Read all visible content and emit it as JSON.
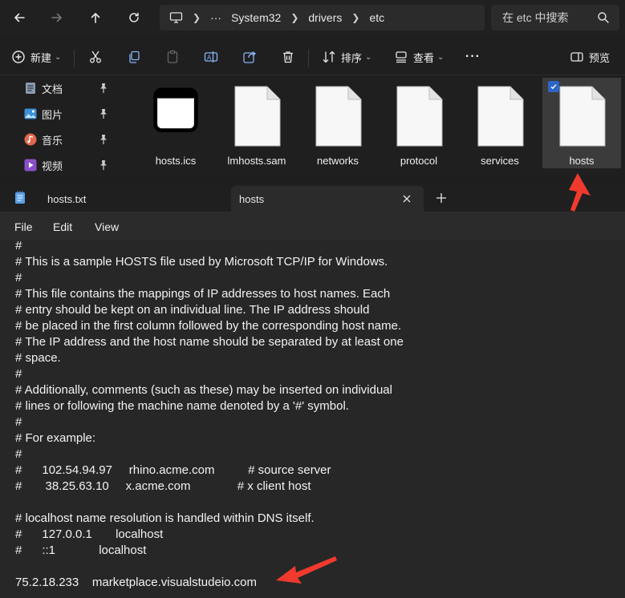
{
  "explorer": {
    "address": {
      "overflow": "···",
      "segments": [
        "System32",
        "drivers",
        "etc"
      ]
    },
    "search_placeholder": "在 etc 中搜索",
    "toolbar": {
      "new_label": "新建",
      "sort_label": "排序",
      "view_label": "查看",
      "more_label": "···",
      "preview_label": "预览"
    },
    "sidebar": [
      {
        "label": "文档",
        "icon": "documents-icon",
        "color": "#8a9bb0"
      },
      {
        "label": "图片",
        "icon": "pictures-icon",
        "color": "#3d8fd6"
      },
      {
        "label": "音乐",
        "icon": "music-icon",
        "color": "#e0684b"
      },
      {
        "label": "视频",
        "icon": "videos-icon",
        "color": "#8a4fc7"
      }
    ],
    "files": [
      {
        "name": "hosts.ics",
        "icon": "window-file-icon"
      },
      {
        "name": "lmhosts.sam",
        "icon": "blank-file-icon"
      },
      {
        "name": "networks",
        "icon": "blank-file-icon"
      },
      {
        "name": "protocol",
        "icon": "blank-file-icon"
      },
      {
        "name": "services",
        "icon": "blank-file-icon"
      },
      {
        "name": "hosts",
        "icon": "blank-file-icon",
        "selected": true
      }
    ]
  },
  "notepad": {
    "tabs": [
      {
        "label": "hosts.txt",
        "active": false
      },
      {
        "label": "hosts",
        "active": true
      }
    ],
    "menu": [
      "File",
      "Edit",
      "View"
    ],
    "lines": [
      "#",
      "# This is a sample HOSTS file used by Microsoft TCP/IP for Windows.",
      "#",
      "# This file contains the mappings of IP addresses to host names. Each",
      "# entry should be kept on an individual line. The IP address should",
      "# be placed in the first column followed by the corresponding host name.",
      "# The IP address and the host name should be separated by at least one",
      "# space.",
      "#",
      "# Additionally, comments (such as these) may be inserted on individual",
      "# lines or following the machine name denoted by a '#' symbol.",
      "#",
      "# For example:",
      "#",
      "#      102.54.94.97     rhino.acme.com          # source server",
      "#       38.25.63.10     x.acme.com              # x client host",
      "",
      "# localhost name resolution is handled within DNS itself.",
      "#      127.0.0.1       localhost",
      "#      ::1             localhost",
      "",
      "75.2.18.233    marketplace.visualstudeio.com"
    ]
  },
  "colors": {
    "annotation_arrow": "#f03a2e",
    "selection_check": "#2d64c8"
  }
}
